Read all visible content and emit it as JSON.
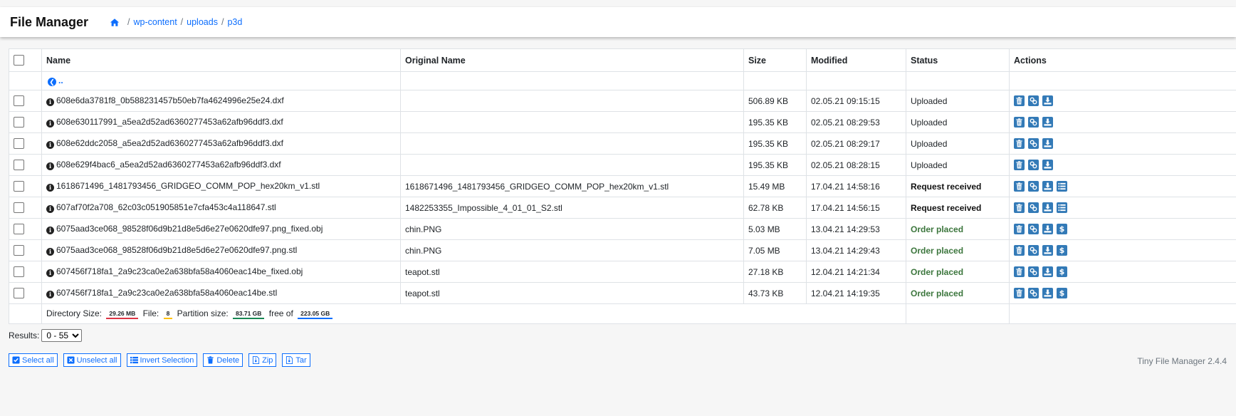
{
  "header": {
    "title": "File Manager",
    "breadcrumb": [
      "wp-content",
      "uploads",
      "p3d"
    ]
  },
  "table": {
    "columns": [
      "Name",
      "Original Name",
      "Size",
      "Modified",
      "Status",
      "Actions"
    ],
    "parent_link": "..",
    "rows": [
      {
        "name": "608e6da3781f8_0b588231457b50eb7fa4624996e25e24.dxf",
        "original": "",
        "size": "506.89 KB",
        "modified": "02.05.21 09:15:15",
        "status": "Uploaded",
        "status_type": "uploaded"
      },
      {
        "name": "608e630117991_a5ea2d52ad6360277453a62afb96ddf3.dxf",
        "original": "",
        "size": "195.35 KB",
        "modified": "02.05.21 08:29:53",
        "status": "Uploaded",
        "status_type": "uploaded"
      },
      {
        "name": "608e62ddc2058_a5ea2d52ad6360277453a62afb96ddf3.dxf",
        "original": "",
        "size": "195.35 KB",
        "modified": "02.05.21 08:29:17",
        "status": "Uploaded",
        "status_type": "uploaded"
      },
      {
        "name": "608e629f4bac6_a5ea2d52ad6360277453a62afb96ddf3.dxf",
        "original": "",
        "size": "195.35 KB",
        "modified": "02.05.21 08:28:15",
        "status": "Uploaded",
        "status_type": "uploaded"
      },
      {
        "name": "1618671496_1481793456_GRIDGEO_COMM_POP_hex20km_v1.stl",
        "original": "1618671496_1481793456_GRIDGEO_COMM_POP_hex20km_v1.stl",
        "size": "15.49 MB",
        "modified": "17.04.21 14:58:16",
        "status": "Request received",
        "status_type": "request"
      },
      {
        "name": "607af70f2a708_62c03c051905851e7cfa453c4a118647.stl",
        "original": "1482253355_Impossible_4_01_01_S2.stl",
        "size": "62.78 KB",
        "modified": "17.04.21 14:56:15",
        "status": "Request received",
        "status_type": "request"
      },
      {
        "name": "6075aad3ce068_98528f06d9b21d8e5d6e27e0620dfe97.png_fixed.obj",
        "original": "chin.PNG",
        "size": "5.03 MB",
        "modified": "13.04.21 14:29:53",
        "status": "Order placed",
        "status_type": "order"
      },
      {
        "name": "6075aad3ce068_98528f06d9b21d8e5d6e27e0620dfe97.png.stl",
        "original": "chin.PNG",
        "size": "7.05 MB",
        "modified": "13.04.21 14:29:43",
        "status": "Order placed",
        "status_type": "order"
      },
      {
        "name": "607456f718fa1_2a9c23ca0e2a638bfa58a4060eac14be_fixed.obj",
        "original": "teapot.stl",
        "size": "27.18 KB",
        "modified": "12.04.21 14:21:34",
        "status": "Order placed",
        "status_type": "order"
      },
      {
        "name": "607456f718fa1_2a9c23ca0e2a638bfa58a4060eac14be.stl",
        "original": "teapot.stl",
        "size": "43.73 KB",
        "modified": "12.04.21 14:19:35",
        "status": "Order placed",
        "status_type": "order"
      }
    ],
    "footer": {
      "dir_size_label": "Directory Size:",
      "dir_size": "29.26 MB",
      "file_label": "File:",
      "file_count": "8",
      "partition_label": "Partition size:",
      "partition_size": "83.71 GB",
      "free_label": "free of",
      "total_size": "223.05 GB"
    }
  },
  "results": {
    "label": "Results:",
    "selected": "0 - 55"
  },
  "actions_bar": {
    "select_all": "Select all",
    "unselect_all": "Unselect all",
    "invert": "Invert Selection",
    "delete": "Delete",
    "zip": "Zip",
    "tar": "Tar"
  },
  "version": "Tiny File Manager 2.4.4",
  "colors": {
    "accent": "#0d6efd",
    "action_button": "#337ab7",
    "order_placed": "#3c763d"
  }
}
